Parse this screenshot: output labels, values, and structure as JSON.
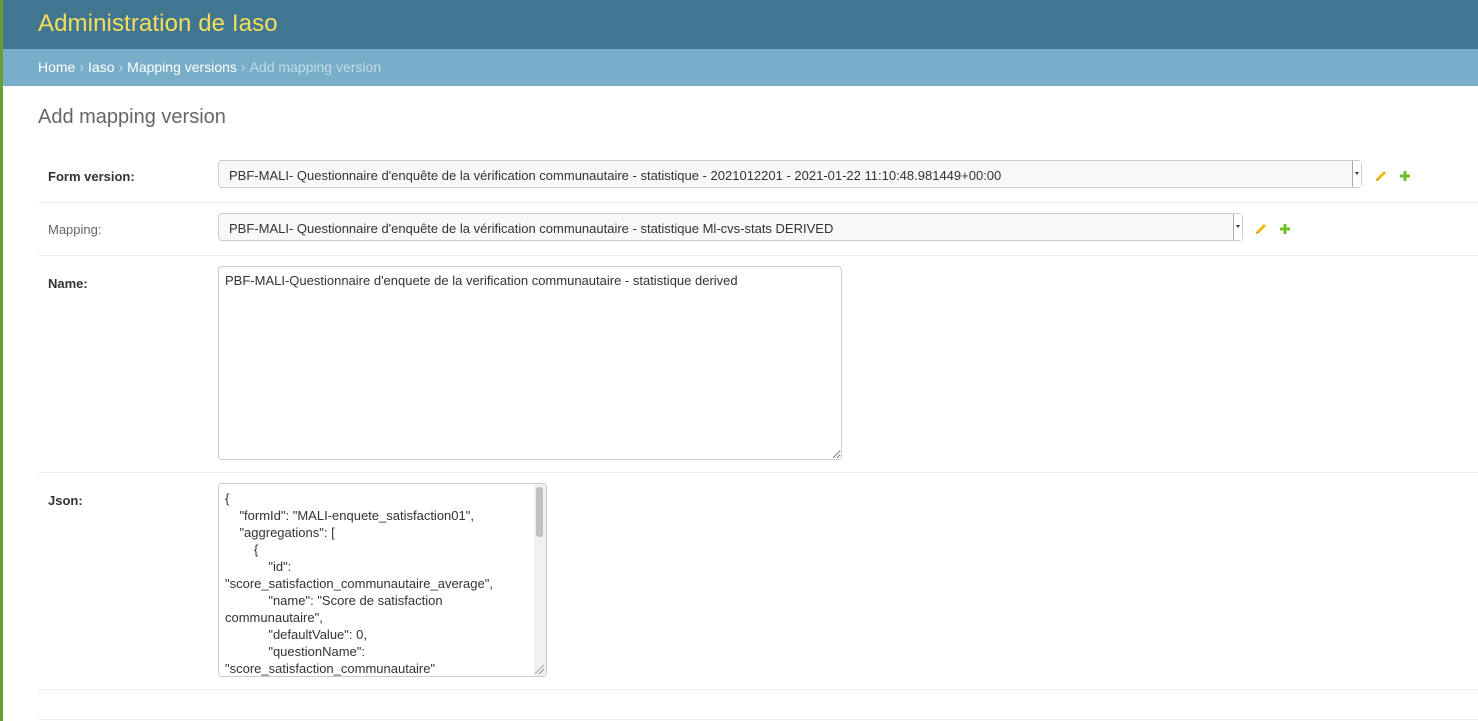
{
  "header": {
    "site_title": "Administration de Iaso"
  },
  "breadcrumbs": {
    "items": [
      "Home",
      "Iaso",
      "Mapping versions"
    ],
    "separator": "›",
    "current": "Add mapping version"
  },
  "page": {
    "title": "Add mapping version"
  },
  "form": {
    "form_version": {
      "label": "Form version:",
      "selected": "PBF-MALI- Questionnaire d'enquête de la vérification communautaire - statistique - 2021012201 - 2021-01-22 11:10:48.981449+00:00"
    },
    "mapping": {
      "label": "Mapping:",
      "selected": "PBF-MALI- Questionnaire d'enquête de la vérification communautaire - statistique Ml-cvs-stats DERIVED"
    },
    "name": {
      "label": "Name:",
      "value": "PBF-MALI-Questionnaire d'enquete de la verification communautaire - statistique derived"
    },
    "json": {
      "label": "Json:",
      "value": "{\n    \"formId\": \"MALI-enquete_satisfaction01\",\n    \"aggregations\": [\n        {\n            \"id\":\n\"score_satisfaction_communautaire_average\",\n            \"name\": \"Score de satisfaction\ncommunautaire\",\n            \"defaultValue\": 0,\n            \"questionName\":\n\"score_satisfaction_communautaire\""
    }
  },
  "icons": {
    "edit": "pencil-icon",
    "add": "plus-icon"
  },
  "colors": {
    "header_bg": "#417690",
    "title": "#f5dd5d",
    "breadcrumb_bg": "#79aec8",
    "edit_icon": "#efb80b",
    "add_icon": "#70bf2b"
  }
}
